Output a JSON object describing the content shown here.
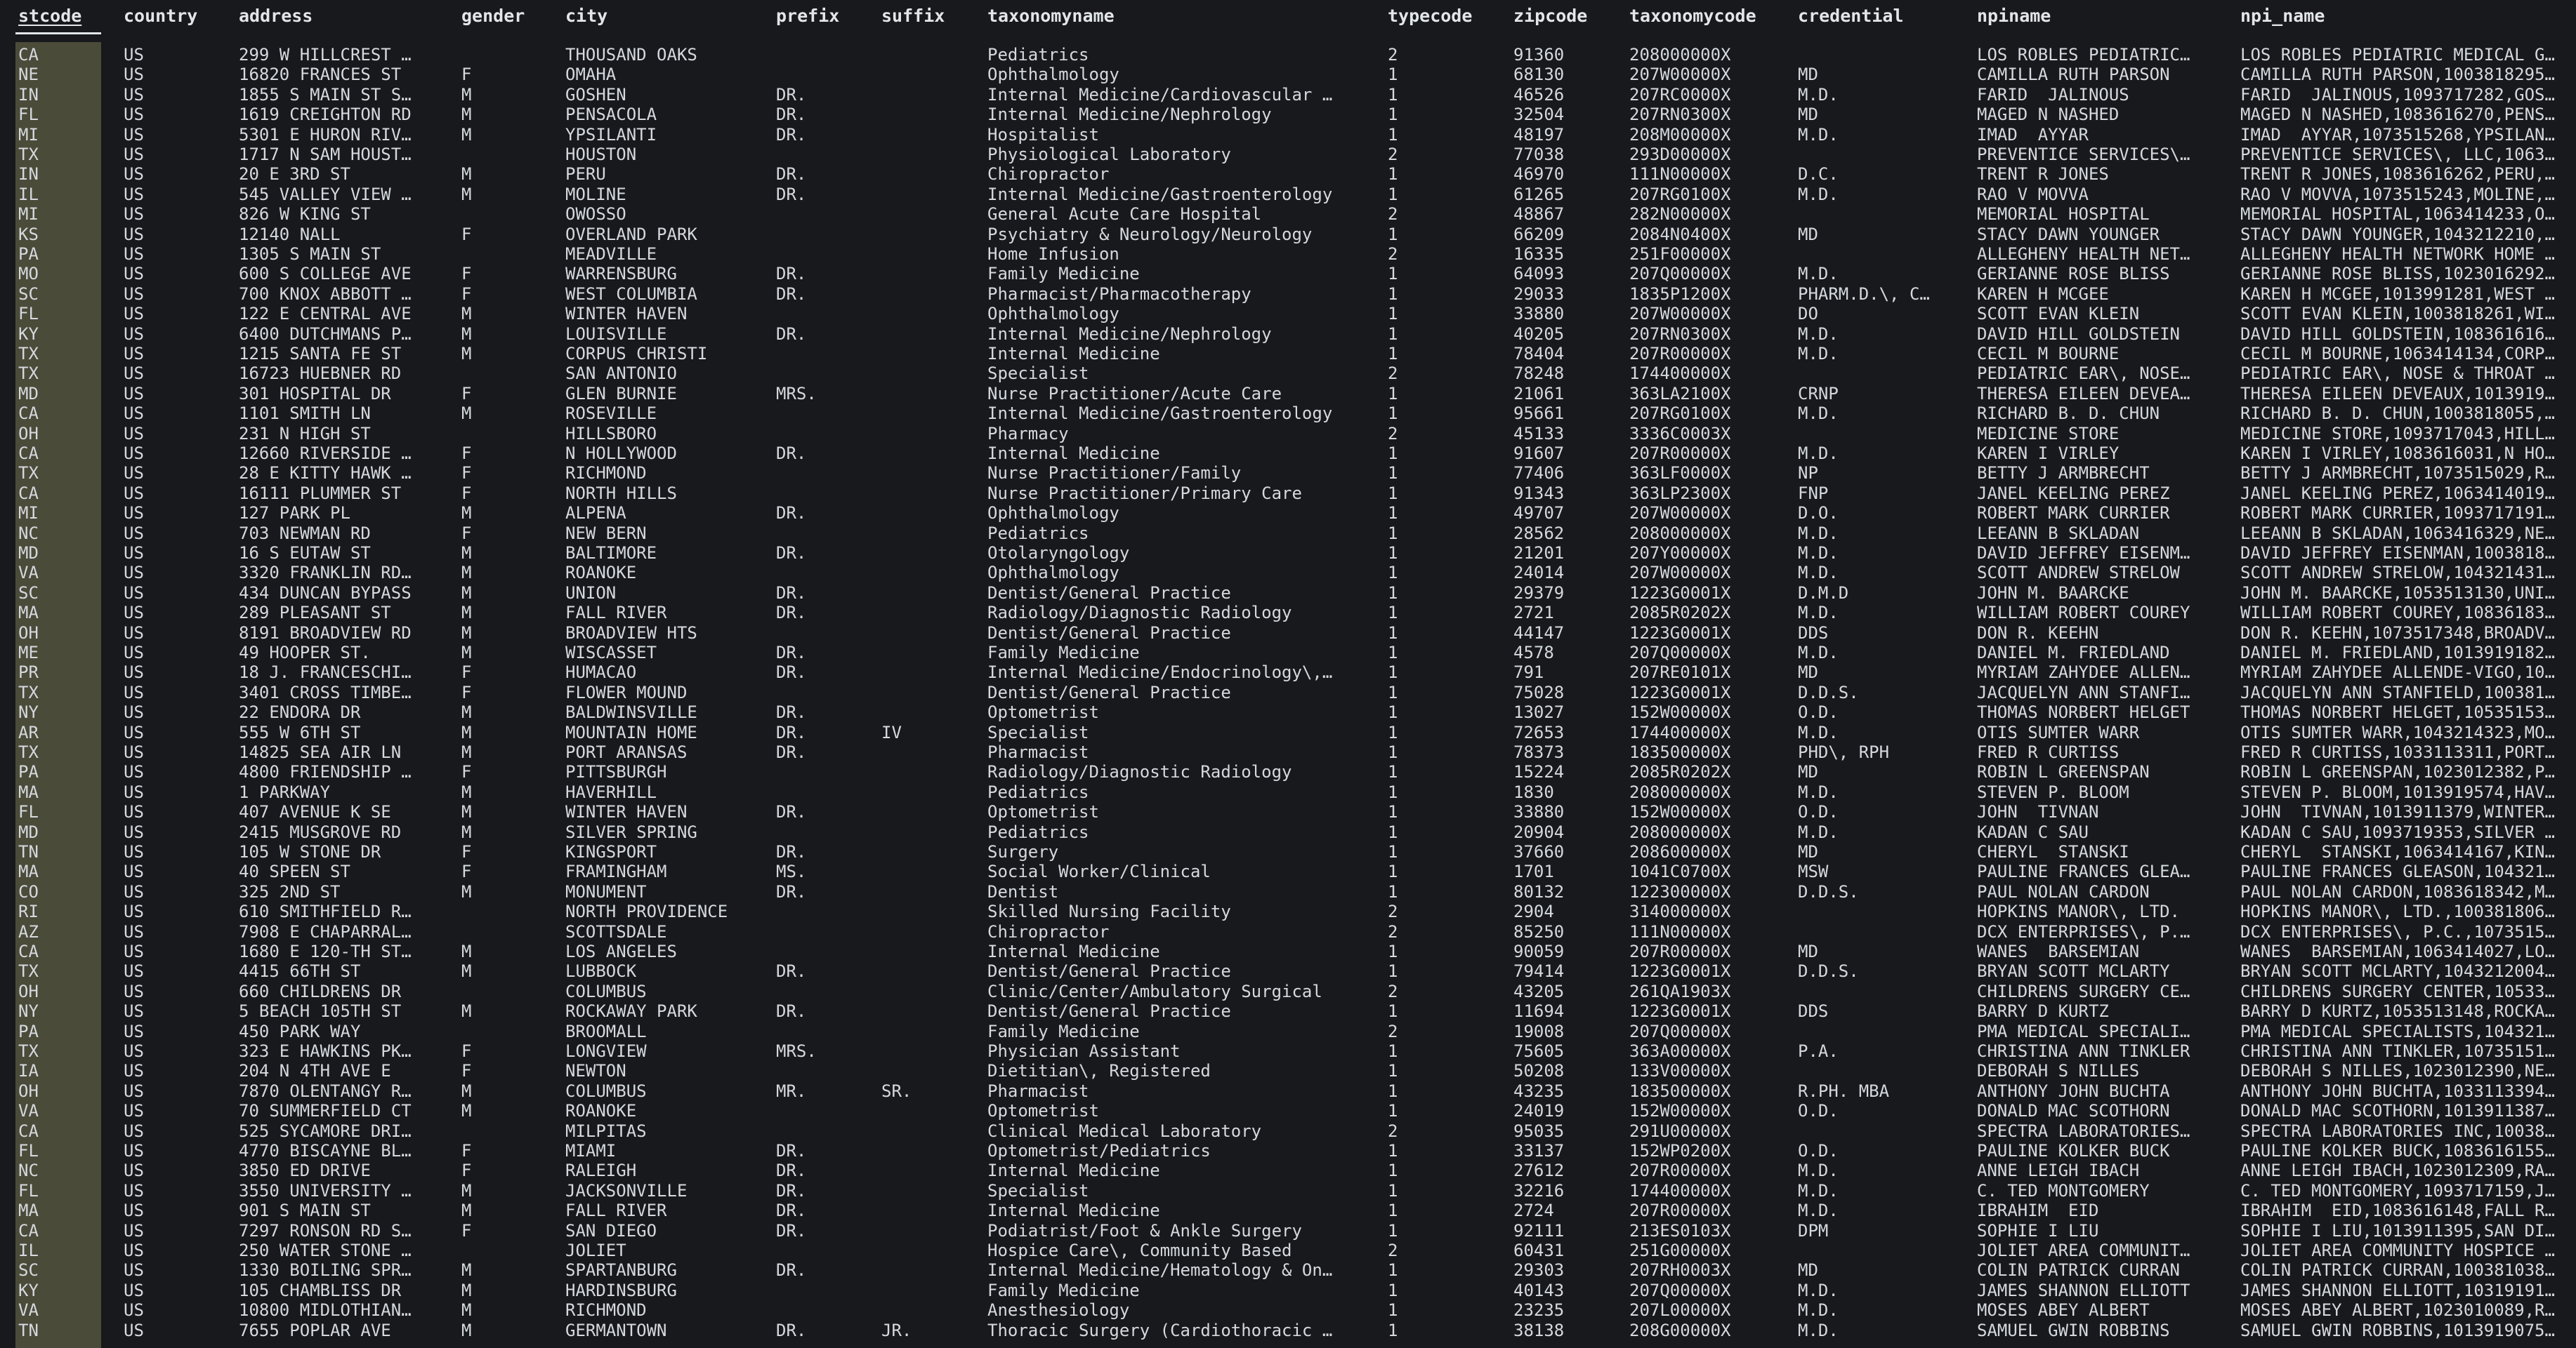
{
  "selected_column": "stcode",
  "columns": [
    "stcode",
    "country",
    "address",
    "gender",
    "city",
    "prefix",
    "suffix",
    "taxonomyname",
    "typecode",
    "zipcode",
    "taxonomycode",
    "credential",
    "npiname",
    "npi_name"
  ],
  "rows": [
    [
      "CA",
      "US",
      "299 W HILLCREST …",
      "",
      "THOUSAND OAKS",
      "",
      "",
      "Pediatrics",
      "2",
      "91360",
      "208000000X",
      "",
      "LOS ROBLES PEDIATRIC…",
      "LOS ROBLES PEDIATRIC MEDICAL G…"
    ],
    [
      "NE",
      "US",
      "16820 FRANCES ST",
      "F",
      "OMAHA",
      "",
      "",
      "Ophthalmology",
      "1",
      "68130",
      "207W00000X",
      "MD",
      "CAMILLA RUTH PARSON",
      "CAMILLA RUTH PARSON,1003818295…"
    ],
    [
      "IN",
      "US",
      "1855 S MAIN ST S…",
      "M",
      "GOSHEN",
      "DR.",
      "",
      "Internal Medicine/Cardiovascular …",
      "1",
      "46526",
      "207RC0000X",
      "M.D.",
      "FARID  JALINOUS",
      "FARID  JALINOUS,1093717282,GOS…"
    ],
    [
      "FL",
      "US",
      "1619 CREIGHTON RD",
      "M",
      "PENSACOLA",
      "DR.",
      "",
      "Internal Medicine/Nephrology",
      "1",
      "32504",
      "207RN0300X",
      "MD",
      "MAGED N NASHED",
      "MAGED N NASHED,1083616270,PENS…"
    ],
    [
      "MI",
      "US",
      "5301 E HURON RIV…",
      "M",
      "YPSILANTI",
      "DR.",
      "",
      "Hospitalist",
      "1",
      "48197",
      "208M00000X",
      "M.D.",
      "IMAD  AYYAR",
      "IMAD  AYYAR,1073515268,YPSILAN…"
    ],
    [
      "TX",
      "US",
      "1717 N SAM HOUST…",
      "",
      "HOUSTON",
      "",
      "",
      "Physiological Laboratory",
      "2",
      "77038",
      "293D00000X",
      "",
      "PREVENTICE SERVICES\\…",
      "PREVENTICE SERVICES\\, LLC,1063…"
    ],
    [
      "IN",
      "US",
      "20 E 3RD ST",
      "M",
      "PERU",
      "DR.",
      "",
      "Chiropractor",
      "1",
      "46970",
      "111N00000X",
      "D.C.",
      "TRENT R JONES",
      "TRENT R JONES,1083616262,PERU,…"
    ],
    [
      "IL",
      "US",
      "545 VALLEY VIEW …",
      "M",
      "MOLINE",
      "DR.",
      "",
      "Internal Medicine/Gastroenterology",
      "1",
      "61265",
      "207RG0100X",
      "M.D.",
      "RAO V MOVVA",
      "RAO V MOVVA,1073515243,MOLINE,…"
    ],
    [
      "MI",
      "US",
      "826 W KING ST",
      "",
      "OWOSSO",
      "",
      "",
      "General Acute Care Hospital",
      "2",
      "48867",
      "282N00000X",
      "",
      "MEMORIAL HOSPITAL",
      "MEMORIAL HOSPITAL,1063414233,O…"
    ],
    [
      "KS",
      "US",
      "12140 NALL",
      "F",
      "OVERLAND PARK",
      "",
      "",
      "Psychiatry & Neurology/Neurology",
      "1",
      "66209",
      "2084N0400X",
      "MD",
      "STACY DAWN YOUNGER",
      "STACY DAWN YOUNGER,1043212210,…"
    ],
    [
      "PA",
      "US",
      "1305 S MAIN ST",
      "",
      "MEADVILLE",
      "",
      "",
      "Home Infusion",
      "2",
      "16335",
      "251F00000X",
      "",
      "ALLEGHENY HEALTH NET…",
      "ALLEGHENY HEALTH NETWORK HOME …"
    ],
    [
      "MO",
      "US",
      "600 S COLLEGE AVE",
      "F",
      "WARRENSBURG",
      "DR.",
      "",
      "Family Medicine",
      "1",
      "64093",
      "207Q00000X",
      "M.D.",
      "GERIANNE ROSE BLISS",
      "GERIANNE ROSE BLISS,1023016292…"
    ],
    [
      "SC",
      "US",
      "700 KNOX ABBOTT …",
      "F",
      "WEST COLUMBIA",
      "DR.",
      "",
      "Pharmacist/Pharmacotherapy",
      "1",
      "29033",
      "1835P1200X",
      "PHARM.D.\\, C…",
      "KAREN H MCGEE",
      "KAREN H MCGEE,1013991281,WEST …"
    ],
    [
      "FL",
      "US",
      "122 E CENTRAL AVE",
      "M",
      "WINTER HAVEN",
      "",
      "",
      "Ophthalmology",
      "1",
      "33880",
      "207W00000X",
      "DO",
      "SCOTT EVAN KLEIN",
      "SCOTT EVAN KLEIN,1003818261,WI…"
    ],
    [
      "KY",
      "US",
      "6400 DUTCHMANS P…",
      "M",
      "LOUISVILLE",
      "DR.",
      "",
      "Internal Medicine/Nephrology",
      "1",
      "40205",
      "207RN0300X",
      "M.D.",
      "DAVID HILL GOLDSTEIN",
      "DAVID HILL GOLDSTEIN,108361616…"
    ],
    [
      "TX",
      "US",
      "1215 SANTA FE ST",
      "M",
      "CORPUS CHRISTI",
      "",
      "",
      "Internal Medicine",
      "1",
      "78404",
      "207R00000X",
      "M.D.",
      "CECIL M BOURNE",
      "CECIL M BOURNE,1063414134,CORP…"
    ],
    [
      "TX",
      "US",
      "16723 HUEBNER RD",
      "",
      "SAN ANTONIO",
      "",
      "",
      "Specialist",
      "2",
      "78248",
      "174400000X",
      "",
      "PEDIATRIC EAR\\, NOSE…",
      "PEDIATRIC EAR\\, NOSE & THROAT …"
    ],
    [
      "MD",
      "US",
      "301 HOSPITAL DR",
      "F",
      "GLEN BURNIE",
      "MRS.",
      "",
      "Nurse Practitioner/Acute Care",
      "1",
      "21061",
      "363LA2100X",
      "CRNP",
      "THERESA EILEEN DEVEA…",
      "THERESA EILEEN DEVEAUX,1013919…"
    ],
    [
      "CA",
      "US",
      "1101 SMITH LN",
      "M",
      "ROSEVILLE",
      "",
      "",
      "Internal Medicine/Gastroenterology",
      "1",
      "95661",
      "207RG0100X",
      "M.D.",
      "RICHARD B. D. CHUN",
      "RICHARD B. D. CHUN,1003818055,…"
    ],
    [
      "OH",
      "US",
      "231 N HIGH ST",
      "",
      "HILLSBORO",
      "",
      "",
      "Pharmacy",
      "2",
      "45133",
      "3336C0003X",
      "",
      "MEDICINE STORE",
      "MEDICINE STORE,1093717043,HILL…"
    ],
    [
      "CA",
      "US",
      "12660 RIVERSIDE …",
      "F",
      "N HOLLYWOOD",
      "DR.",
      "",
      "Internal Medicine",
      "1",
      "91607",
      "207R00000X",
      "M.D.",
      "KAREN I VIRLEY",
      "KAREN I VIRLEY,1083616031,N HO…"
    ],
    [
      "TX",
      "US",
      "28 E KITTY HAWK …",
      "F",
      "RICHMOND",
      "",
      "",
      "Nurse Practitioner/Family",
      "1",
      "77406",
      "363LF0000X",
      "NP",
      "BETTY J ARMBRECHT",
      "BETTY J ARMBRECHT,1073515029,R…"
    ],
    [
      "CA",
      "US",
      "16111 PLUMMER ST",
      "F",
      "NORTH HILLS",
      "",
      "",
      "Nurse Practitioner/Primary Care",
      "1",
      "91343",
      "363LP2300X",
      "FNP",
      "JANEL KEELING PEREZ",
      "JANEL KEELING PEREZ,1063414019…"
    ],
    [
      "MI",
      "US",
      "127 PARK PL",
      "M",
      "ALPENA",
      "DR.",
      "",
      "Ophthalmology",
      "1",
      "49707",
      "207W00000X",
      "D.O.",
      "ROBERT MARK CURRIER",
      "ROBERT MARK CURRIER,1093717191…"
    ],
    [
      "NC",
      "US",
      "703 NEWMAN RD",
      "F",
      "NEW BERN",
      "",
      "",
      "Pediatrics",
      "1",
      "28562",
      "208000000X",
      "M.D.",
      "LEEANN B SKLADAN",
      "LEEANN B SKLADAN,1063416329,NE…"
    ],
    [
      "MD",
      "US",
      "16 S EUTAW ST",
      "M",
      "BALTIMORE",
      "DR.",
      "",
      "Otolaryngology",
      "1",
      "21201",
      "207Y00000X",
      "M.D.",
      "DAVID JEFFREY EISENM…",
      "DAVID JEFFREY EISENMAN,1003818…"
    ],
    [
      "VA",
      "US",
      "3320 FRANKLIN RD…",
      "M",
      "ROANOKE",
      "",
      "",
      "Ophthalmology",
      "1",
      "24014",
      "207W00000X",
      "M.D.",
      "SCOTT ANDREW STRELOW",
      "SCOTT ANDREW STRELOW,104321431…"
    ],
    [
      "SC",
      "US",
      "434 DUNCAN BYPASS",
      "M",
      "UNION",
      "DR.",
      "",
      "Dentist/General Practice",
      "1",
      "29379",
      "1223G0001X",
      "D.M.D",
      "JOHN M. BAARCKE",
      "JOHN M. BAARCKE,1053513130,UNI…"
    ],
    [
      "MA",
      "US",
      "289 PLEASANT ST",
      "M",
      "FALL RIVER",
      "DR.",
      "",
      "Radiology/Diagnostic Radiology",
      "1",
      "2721",
      "2085R0202X",
      "M.D.",
      "WILLIAM ROBERT COUREY",
      "WILLIAM ROBERT COUREY,10836183…"
    ],
    [
      "OH",
      "US",
      "8191 BROADVIEW RD",
      "M",
      "BROADVIEW HTS",
      "",
      "",
      "Dentist/General Practice",
      "1",
      "44147",
      "1223G0001X",
      "DDS",
      "DON R. KEEHN",
      "DON R. KEEHN,1073517348,BROADV…"
    ],
    [
      "ME",
      "US",
      "49 HOOPER ST.",
      "M",
      "WISCASSET",
      "DR.",
      "",
      "Family Medicine",
      "1",
      "4578",
      "207Q00000X",
      "M.D.",
      "DANIEL M. FRIEDLAND",
      "DANIEL M. FRIEDLAND,1013919182…"
    ],
    [
      "PR",
      "US",
      "18 J. FRANCESCHI…",
      "F",
      "HUMACAO",
      "DR.",
      "",
      "Internal Medicine/Endocrinology\\,…",
      "1",
      "791",
      "207RE0101X",
      "MD",
      "MYRIAM ZAHYDEE ALLEN…",
      "MYRIAM ZAHYDEE ALLENDE-VIGO,10…"
    ],
    [
      "TX",
      "US",
      "3401 CROSS TIMBE…",
      "F",
      "FLOWER MOUND",
      "",
      "",
      "Dentist/General Practice",
      "1",
      "75028",
      "1223G0001X",
      "D.D.S.",
      "JACQUELYN ANN STANFI…",
      "JACQUELYN ANN STANFIELD,100381…"
    ],
    [
      "NY",
      "US",
      "22 ENDORA DR",
      "M",
      "BALDWINSVILLE",
      "DR.",
      "",
      "Optometrist",
      "1",
      "13027",
      "152W00000X",
      "O.D.",
      "THOMAS NORBERT HELGET",
      "THOMAS NORBERT HELGET,10535153…"
    ],
    [
      "AR",
      "US",
      "555 W 6TH ST",
      "M",
      "MOUNTAIN HOME",
      "DR.",
      "IV",
      "Specialist",
      "1",
      "72653",
      "174400000X",
      "M.D.",
      "OTIS SUMTER WARR",
      "OTIS SUMTER WARR,1043214323,MO…"
    ],
    [
      "TX",
      "US",
      "14825 SEA AIR LN",
      "M",
      "PORT ARANSAS",
      "DR.",
      "",
      "Pharmacist",
      "1",
      "78373",
      "183500000X",
      "PHD\\, RPH",
      "FRED R CURTISS",
      "FRED R CURTISS,1033113311,PORT…"
    ],
    [
      "PA",
      "US",
      "4800 FRIENDSHIP …",
      "F",
      "PITTSBURGH",
      "",
      "",
      "Radiology/Diagnostic Radiology",
      "1",
      "15224",
      "2085R0202X",
      "MD",
      "ROBIN L GREENSPAN",
      "ROBIN L GREENSPAN,1023012382,P…"
    ],
    [
      "MA",
      "US",
      "1 PARKWAY",
      "M",
      "HAVERHILL",
      "",
      "",
      "Pediatrics",
      "1",
      "1830",
      "208000000X",
      "M.D.",
      "STEVEN P. BLOOM",
      "STEVEN P. BLOOM,1013919574,HAV…"
    ],
    [
      "FL",
      "US",
      "407 AVENUE K SE",
      "M",
      "WINTER HAVEN",
      "DR.",
      "",
      "Optometrist",
      "1",
      "33880",
      "152W00000X",
      "O.D.",
      "JOHN  TIVNAN",
      "JOHN  TIVNAN,1013911379,WINTER…"
    ],
    [
      "MD",
      "US",
      "2415 MUSGROVE RD",
      "M",
      "SILVER SPRING",
      "",
      "",
      "Pediatrics",
      "1",
      "20904",
      "208000000X",
      "M.D.",
      "KADAN C SAU",
      "KADAN C SAU,1093719353,SILVER …"
    ],
    [
      "TN",
      "US",
      "105 W STONE DR",
      "F",
      "KINGSPORT",
      "DR.",
      "",
      "Surgery",
      "1",
      "37660",
      "208600000X",
      "MD",
      "CHERYL  STANSKI",
      "CHERYL  STANSKI,1063414167,KIN…"
    ],
    [
      "MA",
      "US",
      "40 SPEEN ST",
      "F",
      "FRAMINGHAM",
      "MS.",
      "",
      "Social Worker/Clinical",
      "1",
      "1701",
      "1041C0700X",
      "MSW",
      "PAULINE FRANCES GLEA…",
      "PAULINE FRANCES GLEASON,104321…"
    ],
    [
      "CO",
      "US",
      "325 2ND ST",
      "M",
      "MONUMENT",
      "DR.",
      "",
      "Dentist",
      "1",
      "80132",
      "122300000X",
      "D.D.S.",
      "PAUL NOLAN CARDON",
      "PAUL NOLAN CARDON,1083618342,M…"
    ],
    [
      "RI",
      "US",
      "610 SMITHFIELD R…",
      "",
      "NORTH PROVIDENCE",
      "",
      "",
      "Skilled Nursing Facility",
      "2",
      "2904",
      "314000000X",
      "",
      "HOPKINS MANOR\\, LTD.",
      "HOPKINS MANOR\\, LTD.,100381806…"
    ],
    [
      "AZ",
      "US",
      "7908 E CHAPARRAL…",
      "",
      "SCOTTSDALE",
      "",
      "",
      "Chiropractor",
      "2",
      "85250",
      "111N00000X",
      "",
      "DCX ENTERPRISES\\, P.…",
      "DCX ENTERPRISES\\, P.C.,1073515…"
    ],
    [
      "CA",
      "US",
      "1680 E 120-TH ST…",
      "M",
      "LOS ANGELES",
      "",
      "",
      "Internal Medicine",
      "1",
      "90059",
      "207R00000X",
      "MD",
      "WANES  BARSEMIAN",
      "WANES  BARSEMIAN,1063414027,LO…"
    ],
    [
      "TX",
      "US",
      "4415 66TH ST",
      "M",
      "LUBBOCK",
      "DR.",
      "",
      "Dentist/General Practice",
      "1",
      "79414",
      "1223G0001X",
      "D.D.S.",
      "BRYAN SCOTT MCLARTY",
      "BRYAN SCOTT MCLARTY,1043212004…"
    ],
    [
      "OH",
      "US",
      "660 CHILDRENS DR",
      "",
      "COLUMBUS",
      "",
      "",
      "Clinic/Center/Ambulatory Surgical",
      "2",
      "43205",
      "261QA1903X",
      "",
      "CHILDRENS SURGERY CE…",
      "CHILDRENS SURGERY CENTER,10533…"
    ],
    [
      "NY",
      "US",
      "5 BEACH 105TH ST",
      "M",
      "ROCKAWAY PARK",
      "DR.",
      "",
      "Dentist/General Practice",
      "1",
      "11694",
      "1223G0001X",
      "DDS",
      "BARRY D KURTZ",
      "BARRY D KURTZ,1053513148,ROCKA…"
    ],
    [
      "PA",
      "US",
      "450 PARK WAY",
      "",
      "BROOMALL",
      "",
      "",
      "Family Medicine",
      "2",
      "19008",
      "207Q00000X",
      "",
      "PMA MEDICAL SPECIALI…",
      "PMA MEDICAL SPECIALISTS,104321…"
    ],
    [
      "TX",
      "US",
      "323 E HAWKINS PK…",
      "F",
      "LONGVIEW",
      "MRS.",
      "",
      "Physician Assistant",
      "1",
      "75605",
      "363A00000X",
      "P.A.",
      "CHRISTINA ANN TINKLER",
      "CHRISTINA ANN TINKLER,10735151…"
    ],
    [
      "IA",
      "US",
      "204 N 4TH AVE E",
      "F",
      "NEWTON",
      "",
      "",
      "Dietitian\\, Registered",
      "1",
      "50208",
      "133V00000X",
      "",
      "DEBORAH S NILLES",
      "DEBORAH S NILLES,1023012390,NE…"
    ],
    [
      "OH",
      "US",
      "7870 OLENTANGY R…",
      "M",
      "COLUMBUS",
      "MR.",
      "SR.",
      "Pharmacist",
      "1",
      "43235",
      "183500000X",
      "R.PH. MBA",
      "ANTHONY JOHN BUCHTA",
      "ANTHONY JOHN BUCHTA,1033113394…"
    ],
    [
      "VA",
      "US",
      "70 SUMMERFIELD CT",
      "M",
      "ROANOKE",
      "",
      "",
      "Optometrist",
      "1",
      "24019",
      "152W00000X",
      "O.D.",
      "DONALD MAC SCOTHORN",
      "DONALD MAC SCOTHORN,1013911387…"
    ],
    [
      "CA",
      "US",
      "525 SYCAMORE DRI…",
      "",
      "MILPITAS",
      "",
      "",
      "Clinical Medical Laboratory",
      "2",
      "95035",
      "291U00000X",
      "",
      "SPECTRA LABORATORIES…",
      "SPECTRA LABORATORIES INC,10038…"
    ],
    [
      "FL",
      "US",
      "4770 BISCAYNE BL…",
      "F",
      "MIAMI",
      "DR.",
      "",
      "Optometrist/Pediatrics",
      "1",
      "33137",
      "152WP0200X",
      "O.D.",
      "PAULINE KOLKER BUCK",
      "PAULINE KOLKER BUCK,1083616155…"
    ],
    [
      "NC",
      "US",
      "3850 ED DRIVE",
      "F",
      "RALEIGH",
      "DR.",
      "",
      "Internal Medicine",
      "1",
      "27612",
      "207R00000X",
      "M.D.",
      "ANNE LEIGH IBACH",
      "ANNE LEIGH IBACH,1023012309,RA…"
    ],
    [
      "FL",
      "US",
      "3550 UNIVERSITY …",
      "M",
      "JACKSONVILLE",
      "DR.",
      "",
      "Specialist",
      "1",
      "32216",
      "174400000X",
      "M.D.",
      "C. TED MONTGOMERY",
      "C. TED MONTGOMERY,1093717159,J…"
    ],
    [
      "MA",
      "US",
      "901 S MAIN ST",
      "M",
      "FALL RIVER",
      "DR.",
      "",
      "Internal Medicine",
      "1",
      "2724",
      "207R00000X",
      "M.D.",
      "IBRAHIM  EID",
      "IBRAHIM  EID,1083616148,FALL R…"
    ],
    [
      "CA",
      "US",
      "7297 RONSON RD S…",
      "F",
      "SAN DIEGO",
      "DR.",
      "",
      "Podiatrist/Foot & Ankle Surgery",
      "1",
      "92111",
      "213ES0103X",
      "DPM",
      "SOPHIE I LIU",
      "SOPHIE I LIU,1013911395,SAN DI…"
    ],
    [
      "IL",
      "US",
      "250 WATER STONE …",
      "",
      "JOLIET",
      "",
      "",
      "Hospice Care\\, Community Based",
      "2",
      "60431",
      "251G00000X",
      "",
      "JOLIET AREA COMMUNIT…",
      "JOLIET AREA COMMUNITY HOSPICE …"
    ],
    [
      "SC",
      "US",
      "1330 BOILING SPR…",
      "M",
      "SPARTANBURG",
      "DR.",
      "",
      "Internal Medicine/Hematology & On…",
      "1",
      "29303",
      "207RH0003X",
      "MD",
      "COLIN PATRICK CURRAN",
      "COLIN PATRICK CURRAN,100381038…"
    ],
    [
      "KY",
      "US",
      "105 CHAMBLISS DR",
      "M",
      "HARDINSBURG",
      "",
      "",
      "Family Medicine",
      "1",
      "40143",
      "207Q00000X",
      "M.D.",
      "JAMES SHANNON ELLIOTT",
      "JAMES SHANNON ELLIOTT,10319191…"
    ],
    [
      "VA",
      "US",
      "10800 MIDLOTHIAN…",
      "M",
      "RICHMOND",
      "",
      "",
      "Anesthesiology",
      "1",
      "23235",
      "207L00000X",
      "M.D.",
      "MOSES ABEY ALBERT",
      "MOSES ABEY ALBERT,1023010089,R…"
    ],
    [
      "TN",
      "US",
      "7655 POPLAR AVE",
      "M",
      "GERMANTOWN",
      "DR.",
      "JR.",
      "Thoracic Surgery (Cardiothoracic …",
      "1",
      "38138",
      "208G00000X",
      "M.D.",
      "SAMUEL GWIN ROBBINS",
      "SAMUEL GWIN ROBBINS,1013919075…"
    ]
  ]
}
